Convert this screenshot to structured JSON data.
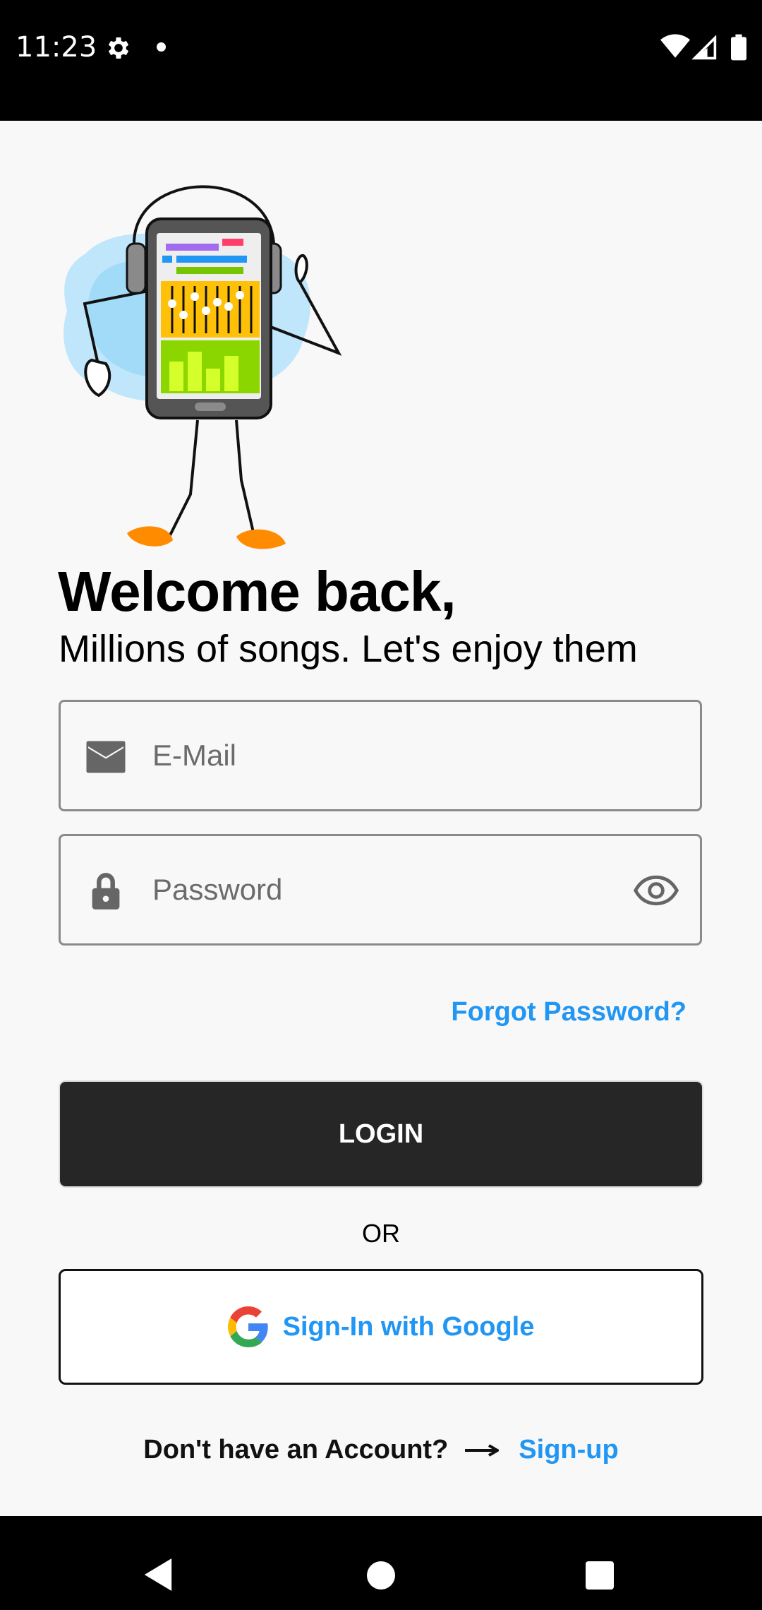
{
  "status_bar": {
    "time": "11:23",
    "icons": [
      "gear-icon",
      "notification-dot-icon",
      "wifi-icon",
      "signal-icon",
      "battery-icon"
    ]
  },
  "illustration": {
    "icon": "phone-headphones-character-illustration"
  },
  "header": {
    "title": "Welcome back,",
    "subtitle": "Millions of songs. Let's enjoy them"
  },
  "form": {
    "email": {
      "placeholder": "E-Mail",
      "value": "",
      "icon": "mail-icon"
    },
    "password": {
      "placeholder": "Password",
      "value": "",
      "icon": "lock-icon",
      "toggle_icon": "eye-icon"
    },
    "forgot_label": "Forgot Password?",
    "login_label": "LOGIN",
    "or_label": "OR",
    "google_label": "Sign-In with Google",
    "google_icon": "google-g-icon"
  },
  "signup": {
    "prompt": "Don't have an Account?",
    "link": "Sign-up",
    "arrow_icon": "arrow-right-icon"
  },
  "nav_bar": {
    "icons": [
      "back-icon",
      "home-icon",
      "recents-icon"
    ]
  },
  "colors": {
    "accent": "#2196f3",
    "button_dark": "#262626",
    "background": "#f8f8f8"
  }
}
